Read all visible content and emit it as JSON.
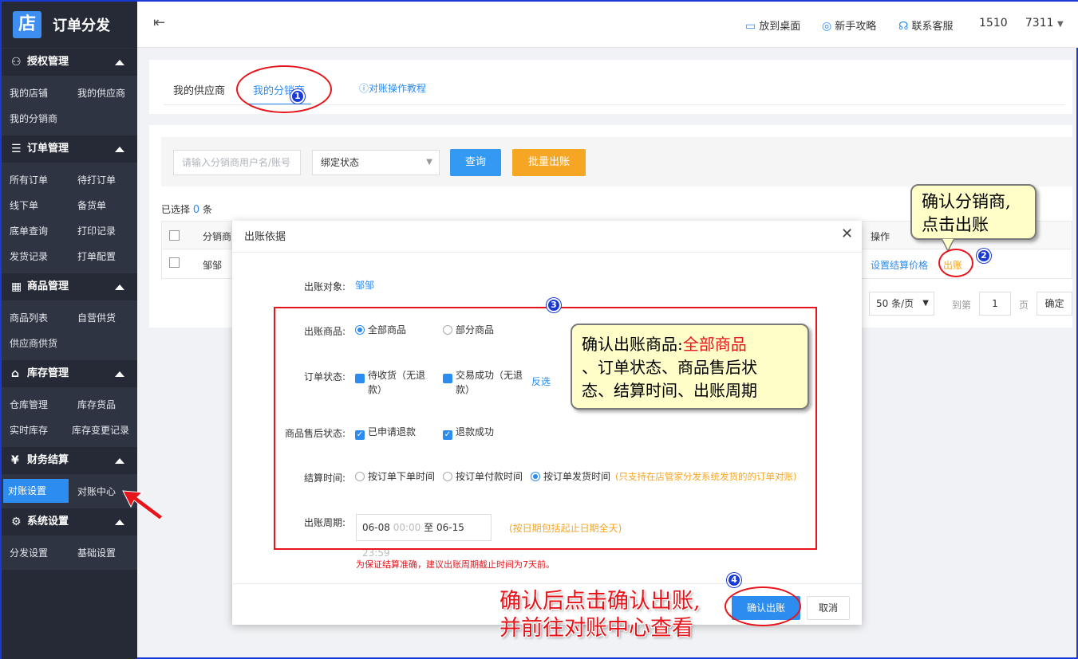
{
  "brand": {
    "logo": "店",
    "title": "订单分发"
  },
  "sidebar": {
    "groups": [
      {
        "icon": "user-icon",
        "glyph": "⚇",
        "label": "授权管理",
        "items": [
          "我的店铺",
          "我的供应商",
          "我的分销商"
        ]
      },
      {
        "icon": "order-icon",
        "glyph": "☰",
        "label": "订单管理",
        "items": [
          "所有订单",
          "待打订单",
          "线下单",
          "备货单",
          "底单查询",
          "打印记录",
          "发货记录",
          "打单配置"
        ]
      },
      {
        "icon": "grid-icon",
        "glyph": "▦",
        "label": "商品管理",
        "items": [
          "商品列表",
          "自营供货",
          "供应商供货"
        ]
      },
      {
        "icon": "home-icon",
        "glyph": "⌂",
        "label": "库存管理",
        "items": [
          "仓库管理",
          "库存货品",
          "实时库存",
          "库存变更记录"
        ]
      },
      {
        "icon": "yen-icon",
        "glyph": "¥",
        "label": "财务结算",
        "items": [
          "对账设置",
          "对账中心"
        ]
      },
      {
        "icon": "settings-icon",
        "glyph": "⚙",
        "label": "系统设置",
        "items": [
          "分发设置",
          "基础设置"
        ]
      }
    ]
  },
  "header": {
    "menu_glyph": "⇤",
    "links": [
      "放到桌面",
      "新手攻略",
      "联系客服"
    ],
    "user": "1510     7311"
  },
  "tabs": {
    "supplier": "我的供应商",
    "distributor": "我的分销商",
    "tutorial": "对账操作教程"
  },
  "filter": {
    "search_placeholder": "请输入分销商用户名/账号",
    "status_select": "绑定状态",
    "query": "查询",
    "batch": "批量出账"
  },
  "selection": {
    "prefix": "已选择",
    "count": "0",
    "suffix": "条"
  },
  "table": {
    "col_name": "分销商",
    "col_op": "操作",
    "row_name": "邹邹",
    "set_price": "设置结算价格",
    "bill": "出账"
  },
  "pagination": {
    "page_size": "50 条/页",
    "goto": "到第",
    "page": "1",
    "page_unit": "页",
    "confirm": "确定"
  },
  "modal": {
    "title": "出账依据",
    "target_label": "出账对象:",
    "target_value": "邹邹",
    "goods_label": "出账商品:",
    "goods_all": "全部商品",
    "goods_part": "部分商品",
    "status_label": "订单状态:",
    "status_1": "待收货（无退款）",
    "status_2": "交易成功（无退款）",
    "invert": "反选",
    "after_label": "商品售后状态:",
    "after_1": "已申请退款",
    "after_2": "退款成功",
    "time_label": "结算时间:",
    "time_1": "按订单下单时间",
    "time_2": "按订单付款时间",
    "time_3": "按订单发货时间",
    "time_note": "(只支持在店管家分发系统发货的的订单对账)",
    "period_label": "出账周期:",
    "date_start": "06-08",
    "time_start": "00:00",
    "date_to": "至",
    "date_end": "06-15",
    "time_end": "23:59",
    "period_note": "(按日期包括起止日期全天)",
    "warn": "为保证结算准确，建议出账周期截止时间为7天前。",
    "ok": "确认出账",
    "cancel": "取消"
  },
  "annotations": {
    "c2_line1": "确认分销商,",
    "c2_line2": "点击出账",
    "c3_a": "确认出账商品:",
    "c3_b": "全部商品",
    "c3_line2": "、订单状态、商品售后状",
    "c3_line3": "态、结算时间、出账周期",
    "c4_line1": "确认后点击确认出账,",
    "c4_line2": "并前往对账中心查看",
    "n1": "1",
    "n2": "2",
    "n3": "3",
    "n4": "4"
  },
  "colors": {
    "accent": "#2d8cf0",
    "orange": "#f5a623",
    "red": "#e8141b",
    "sidebar": "#2f3442"
  }
}
